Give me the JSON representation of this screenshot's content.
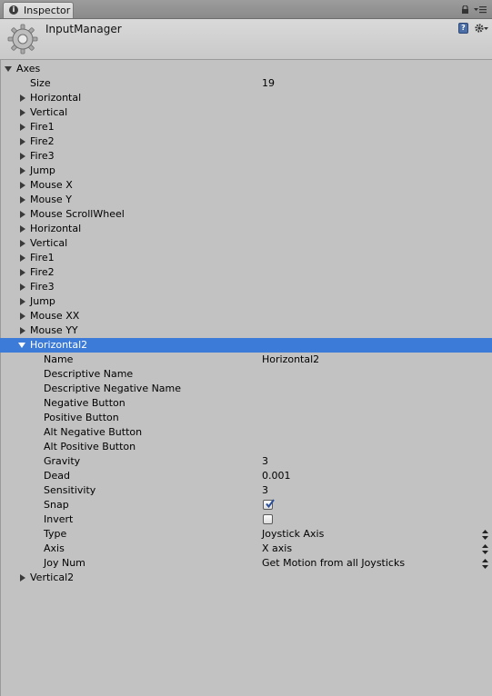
{
  "tab": {
    "label": "Inspector"
  },
  "header": {
    "title": "InputManager"
  },
  "axes": {
    "label": "Axes",
    "size_label": "Size",
    "size_value": "19"
  },
  "items": [
    "Horizontal",
    "Vertical",
    "Fire1",
    "Fire2",
    "Fire3",
    "Jump",
    "Mouse X",
    "Mouse Y",
    "Mouse ScrollWheel",
    "Horizontal",
    "Vertical",
    "Fire1",
    "Fire2",
    "Fire3",
    "Jump",
    "Mouse XX",
    "Mouse YY"
  ],
  "selected": {
    "label": "Horizontal2",
    "fields": {
      "name": {
        "label": "Name",
        "value": "Horizontal2"
      },
      "descriptive_name": {
        "label": "Descriptive Name",
        "value": ""
      },
      "descriptive_negative_name": {
        "label": "Descriptive Negative Name",
        "value": ""
      },
      "negative_button": {
        "label": "Negative Button",
        "value": ""
      },
      "positive_button": {
        "label": "Positive Button",
        "value": ""
      },
      "alt_negative_button": {
        "label": "Alt Negative Button",
        "value": ""
      },
      "alt_positive_button": {
        "label": "Alt Positive Button",
        "value": ""
      },
      "gravity": {
        "label": "Gravity",
        "value": "3"
      },
      "dead": {
        "label": "Dead",
        "value": "0.001"
      },
      "sensitivity": {
        "label": "Sensitivity",
        "value": "3"
      },
      "snap": {
        "label": "Snap",
        "checked": true
      },
      "invert": {
        "label": "Invert",
        "checked": false
      },
      "type": {
        "label": "Type",
        "value": "Joystick Axis"
      },
      "axis": {
        "label": "Axis",
        "value": "X axis"
      },
      "joy_num": {
        "label": "Joy Num",
        "value": "Get Motion from all Joysticks"
      }
    }
  },
  "after": {
    "label": "Vertical2"
  },
  "colors": {
    "selection": "#3d7bd8",
    "background": "#c2c2c2"
  }
}
